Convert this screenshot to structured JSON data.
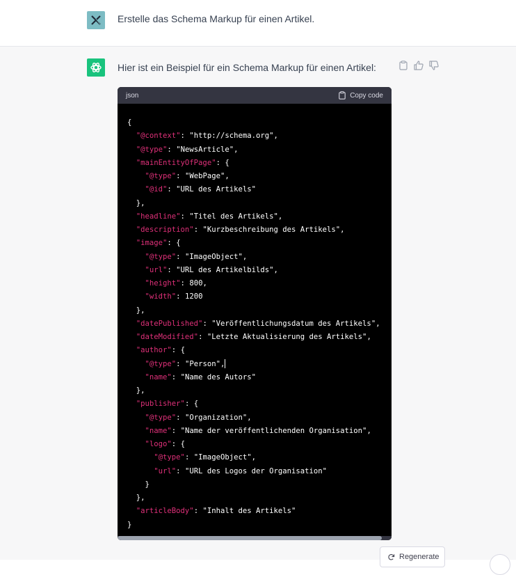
{
  "user_message": {
    "text": "Erstelle das Schema Markup für einen Artikel."
  },
  "assistant": {
    "intro": "Hier ist ein Beispiel für ein Schema Markup für einen Artikel:"
  },
  "code_block": {
    "language": "json",
    "copy_label": "Copy code",
    "lines": [
      "{",
      "  \"@context\": \"http://schema.org\",",
      "  \"@type\": \"NewsArticle\",",
      "  \"mainEntityOfPage\": {",
      "    \"@type\": \"WebPage\",",
      "    \"@id\": \"URL des Artikels\"",
      "  },",
      "  \"headline\": \"Titel des Artikels\",",
      "  \"description\": \"Kurzbeschreibung des Artikels\",",
      "  \"image\": {",
      "    \"@type\": \"ImageObject\",",
      "    \"url\": \"URL des Artikelbilds\",",
      "    \"height\": 800,",
      "    \"width\": 1200",
      "  },",
      "  \"datePublished\": \"Veröffentlichungsdatum des Artikels\",",
      "  \"dateModified\": \"Letzte Aktualisierung des Artikels\",",
      "  \"author\": {",
      "    \"@type\": \"Person\",",
      "    \"name\": \"Name des Autors\"",
      "  },",
      "  \"publisher\": {",
      "    \"@type\": \"Organization\",",
      "    \"name\": \"Name der veröffentlichenden Organisation\",",
      "    \"logo\": {",
      "      \"@type\": \"ImageObject\",",
      "      \"url\": \"URL des Logos der Organisation\"",
      "    }",
      "  },",
      "  \"articleBody\": \"Inhalt des Artikels\"",
      "}"
    ]
  },
  "regenerate_label": "Regenerate",
  "icons": {
    "user_avatar": "x-logo-icon",
    "bot_avatar": "openai-logo-icon",
    "copy": "clipboard-icon",
    "thumbs_up": "thumbs-up-icon",
    "thumbs_down": "thumbs-down-icon",
    "regenerate": "refresh-icon"
  },
  "colors": {
    "user_avatar_bg": "#7dbcc4",
    "bot_avatar_bg": "#19c37d",
    "code_bg": "#000000",
    "code_header_bg": "#343541",
    "json_key": "#df3079",
    "json_string": "#00a67d"
  }
}
